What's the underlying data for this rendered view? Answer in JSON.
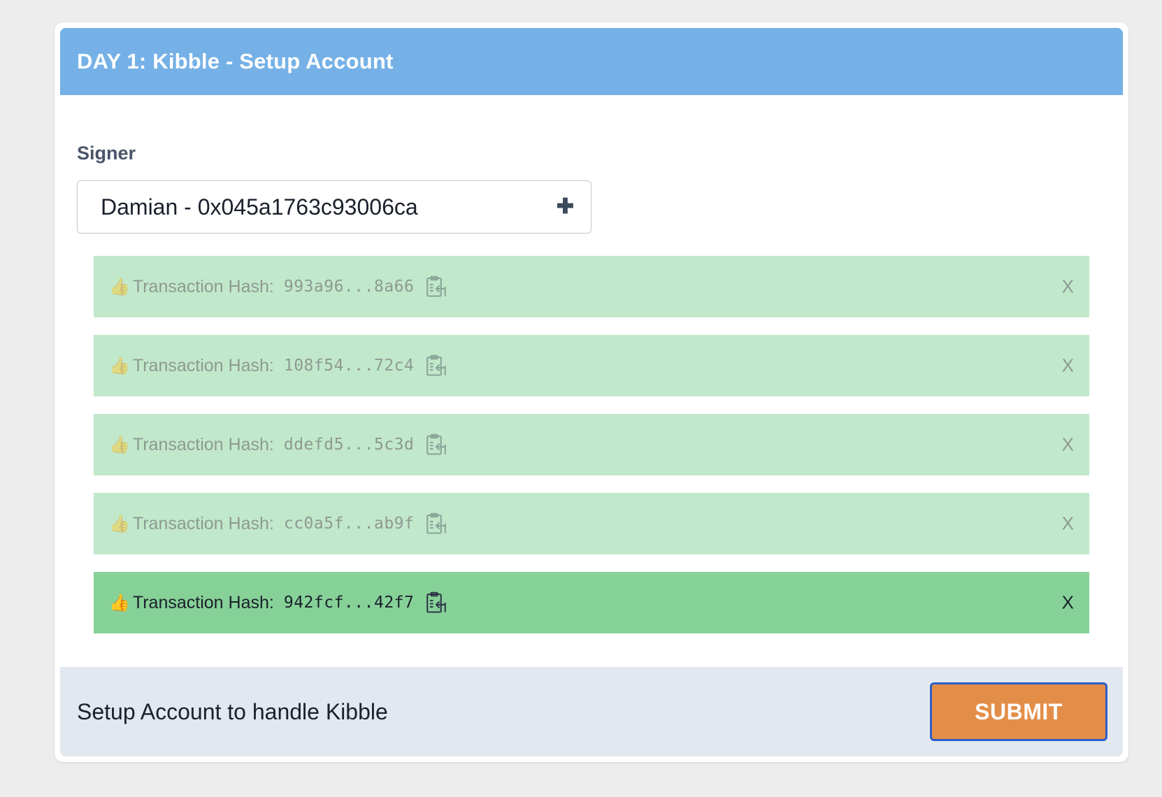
{
  "header": {
    "title": "DAY 1: Kibble - Setup Account"
  },
  "signer": {
    "label": "Signer",
    "value": "Damian - 0x045a1763c93006ca",
    "add_icon": "plus-icon"
  },
  "transactions": [
    {
      "emoji": "👍",
      "label": "Transaction Hash:",
      "hash": "993a96...8a66",
      "close": "X",
      "active": false
    },
    {
      "emoji": "👍",
      "label": "Transaction Hash:",
      "hash": "108f54...72c4",
      "close": "X",
      "active": false
    },
    {
      "emoji": "👍",
      "label": "Transaction Hash:",
      "hash": "ddefd5...5c3d",
      "close": "X",
      "active": false
    },
    {
      "emoji": "👍",
      "label": "Transaction Hash:",
      "hash": "cc0a5f...ab9f",
      "close": "X",
      "active": false
    },
    {
      "emoji": "👍",
      "label": "Transaction Hash:",
      "hash": "942fcf...42f7",
      "close": "X",
      "active": true
    }
  ],
  "footer": {
    "text": "Setup Account to handle Kibble",
    "submit_label": "SUBMIT"
  },
  "colors": {
    "header_bg": "#75b1e6",
    "tx_bg": "#c2e8cb",
    "tx_active_bg": "#86d197",
    "footer_bg": "#e2e8f0",
    "submit_bg": "#e38e48",
    "submit_border": "#2e5ec8"
  }
}
